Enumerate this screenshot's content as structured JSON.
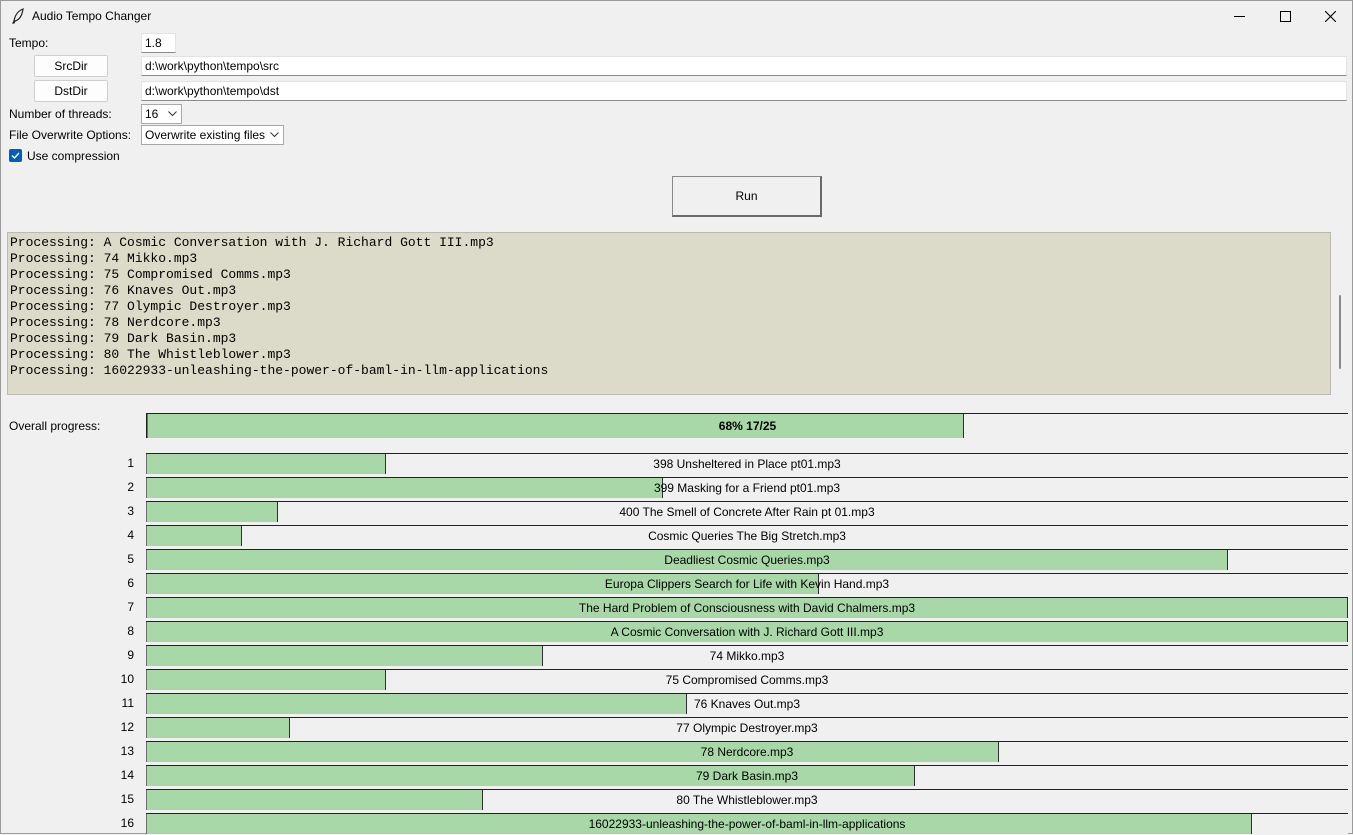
{
  "window": {
    "title": "Audio Tempo Changer",
    "icon": "feather-icon"
  },
  "controls": {
    "tempo_label": "Tempo:",
    "tempo_value": "1.8",
    "srcdir_button": "SrcDir",
    "srcdir_value": "d:\\work\\python\\tempo\\src",
    "dstdir_button": "DstDir",
    "dstdir_value": "d:\\work\\python\\tempo\\dst",
    "threads_label": "Number of threads:",
    "threads_value": "16",
    "overwrite_label": "File Overwrite Options:",
    "overwrite_value": "Overwrite existing files",
    "compression_label": "Use compression",
    "compression_checked": true,
    "run_button": "Run"
  },
  "log": [
    "Processing: A Cosmic Conversation with J. Richard Gott III.mp3",
    "Processing: 74 Mikko.mp3",
    "Processing: 75 Compromised Comms.mp3",
    "Processing: 76 Knaves Out.mp3",
    "Processing: 77 Olympic Destroyer.mp3",
    "Processing: 78 Nerdcore.mp3",
    "Processing: 79 Dark Basin.mp3",
    "Processing: 80 The Whistleblower.mp3",
    "Processing: 16022933-unleashing-the-power-of-baml-in-llm-applications"
  ],
  "overall": {
    "label": "Overall progress:",
    "text": "68%  17/25",
    "progress": 0.68
  },
  "tasks": [
    {
      "num": "1",
      "name": "398 Unsheltered in Place pt01.mp3",
      "progress": 0.2
    },
    {
      "num": "2",
      "name": "399 Masking for a Friend pt01.mp3",
      "progress": 0.43
    },
    {
      "num": "3",
      "name": "400 The Smell of Concrete After Rain pt 01.mp3",
      "progress": 0.11
    },
    {
      "num": "4",
      "name": "Cosmic Queries The Big Stretch.mp3",
      "progress": 0.08
    },
    {
      "num": "5",
      "name": "Deadliest Cosmic Queries.mp3",
      "progress": 0.9
    },
    {
      "num": "6",
      "name": "Europa Clippers Search for Life with Kevin Hand.mp3",
      "progress": 0.56
    },
    {
      "num": "7",
      "name": "The Hard Problem of Consciousness with David Chalmers.mp3",
      "progress": 1.0
    },
    {
      "num": "8",
      "name": "A Cosmic Conversation with J. Richard Gott III.mp3",
      "progress": 1.0
    },
    {
      "num": "9",
      "name": "74 Mikko.mp3",
      "progress": 0.33
    },
    {
      "num": "10",
      "name": "75 Compromised Comms.mp3",
      "progress": 0.2
    },
    {
      "num": "11",
      "name": "76 Knaves Out.mp3",
      "progress": 0.45
    },
    {
      "num": "12",
      "name": "77 Olympic Destroyer.mp3",
      "progress": 0.12
    },
    {
      "num": "13",
      "name": "78 Nerdcore.mp3",
      "progress": 0.71
    },
    {
      "num": "14",
      "name": "79 Dark Basin.mp3",
      "progress": 0.64
    },
    {
      "num": "15",
      "name": "80 The Whistleblower.mp3",
      "progress": 0.28
    },
    {
      "num": "16",
      "name": "16022933-unleashing-the-power-of-baml-in-llm-applications",
      "progress": 0.92
    }
  ]
}
